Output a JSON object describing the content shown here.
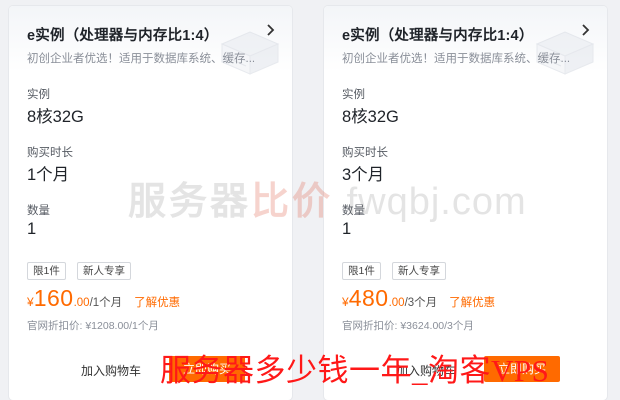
{
  "cards": [
    {
      "title": "e实例（处理器与内存比1:4）",
      "subtitle": "初创企业者优选！适用于数据库系统、缓存...",
      "instance_label": "实例",
      "instance_value": "8核32G",
      "duration_label": "购买时长",
      "duration_value": "1个月",
      "quantity_label": "数量",
      "quantity_value": "1",
      "tags": [
        "限1件",
        "新人专享"
      ],
      "price_currency": "¥",
      "price_integer": "160",
      "price_decimal": ".00",
      "price_unit": "/1个月",
      "discount_link": "了解优惠",
      "official_price": "官网折扣价: ¥1208.00/1个月",
      "cart_label": "加入购物车",
      "buy_label": "立即购买"
    },
    {
      "title": "e实例（处理器与内存比1:4）",
      "subtitle": "初创企业者优选！适用于数据库系统、缓存...",
      "instance_label": "实例",
      "instance_value": "8核32G",
      "duration_label": "购买时长",
      "duration_value": "3个月",
      "quantity_label": "数量",
      "quantity_value": "1",
      "tags": [
        "限1件",
        "新人专享"
      ],
      "price_currency": "¥",
      "price_integer": "480",
      "price_decimal": ".00",
      "price_unit": "/3个月",
      "discount_link": "了解优惠",
      "official_price": "官网折扣价: ¥3624.00/3个月",
      "cart_label": "加入购物车",
      "buy_label": "立即购买"
    }
  ],
  "watermark": {
    "center_text_1": "服务器",
    "center_text_2": "比价",
    "center_domain": "fwqbj.com",
    "bottom_caption": "服务器多少钱一年_淘客VPS"
  },
  "colors": {
    "accent": "#ff6a00",
    "watermark_red": "#ff1818"
  }
}
